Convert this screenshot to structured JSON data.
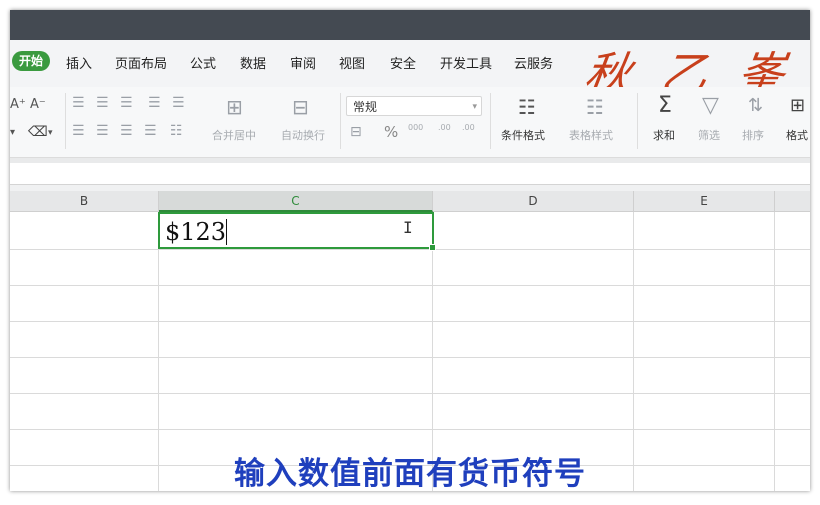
{
  "menu": {
    "start": "开始",
    "items": [
      "插入",
      "页面布局",
      "公式",
      "数据",
      "审阅",
      "视图",
      "安全",
      "开发工具",
      "云服务"
    ]
  },
  "brand": "秋 乙 峯",
  "ribbon": {
    "merge_center": "合并居中",
    "wrap_text": "自动换行",
    "number_format": "常规",
    "conditional_format": "条件格式",
    "table_style": "表格样式",
    "sum": "求和",
    "filter": "筛选",
    "sort": "排序",
    "format": "格式",
    "percent": "%",
    "thousands": "000",
    "inc_decimal": ".00",
    "dec_decimal": ".00"
  },
  "columns": [
    "B",
    "C",
    "D",
    "E"
  ],
  "active_cell": {
    "value": "$123"
  },
  "caption": "输入数值前面有货币符号",
  "colors": {
    "accent_green": "#2e9a3c",
    "caption_blue": "#1f3fbd",
    "brand_red": "#c8401c"
  }
}
